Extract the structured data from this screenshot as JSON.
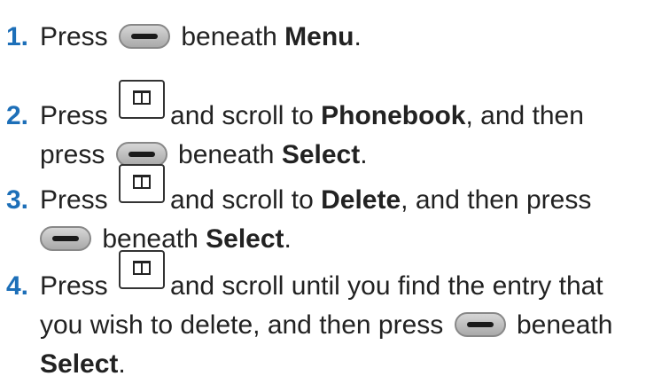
{
  "steps": [
    {
      "number": "1.",
      "press": "Press",
      "beneath": "beneath",
      "target": "Menu",
      "end": "."
    },
    {
      "number": "2.",
      "press": "Press",
      "scroll": "and scroll to",
      "target": "Phonebook",
      "then": ", and then",
      "press2": "press",
      "beneath": "beneath",
      "target2": "Select",
      "end": "."
    },
    {
      "number": "3.",
      "press": "Press",
      "scroll": "and scroll to",
      "target": "Delete",
      "then": ", and then press",
      "beneath": "beneath",
      "target2": "Select",
      "end": "."
    },
    {
      "number": "4.",
      "press": "Press",
      "scroll": "and scroll until you find the entry that",
      "line2": "you wish to delete, and then press",
      "beneath": "beneath",
      "target2": "Select",
      "end": "."
    }
  ],
  "icons": {
    "soft_key": "soft-key-icon",
    "phonebook_key": "phonebook-key-icon"
  },
  "colors": {
    "step_number": "#1d6fb8",
    "text": "#222222"
  }
}
